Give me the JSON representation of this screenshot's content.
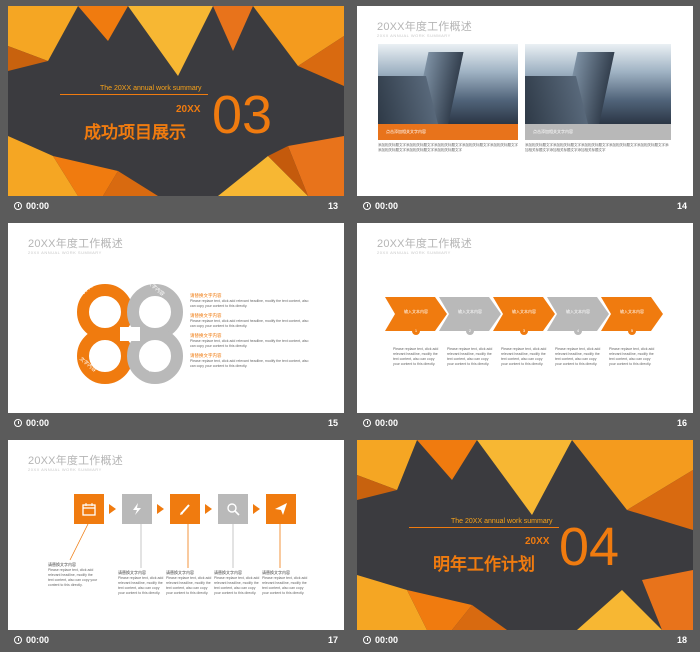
{
  "colors": {
    "accent": "#f07b0f",
    "gray": "#b9b9b9",
    "background": "#5b5b5b",
    "dark_slide": "#3b3b3f"
  },
  "slides": [
    {
      "number": "13",
      "time": "00:00",
      "section": {
        "subtitle": "The 20XX annual work summary",
        "year": "20XX",
        "title": "成功项目展示",
        "num": "03"
      }
    },
    {
      "number": "14",
      "time": "00:00",
      "head": "20XX年度工作概述",
      "sub": "20XX ANNUAL WORK SUMMARY",
      "captions": [
        "点击添加相关文字内容",
        "点击添加相关文字内容"
      ],
      "body": "添加相关标题文字添加相关标题文字添加相关标题文字添加相关标题文字添加相关标题文字添加相关标题文字添加相关标题文字添加相关标题文字"
    },
    {
      "number": "15",
      "time": "00:00",
      "head": "20XX年度工作概述",
      "sub": "20XX ANNUAL WORK SUMMARY",
      "knot_labels": [
        "文字内容",
        "文字内容",
        "文字内容",
        "文字内容"
      ],
      "items": [
        {
          "title": "请替换文字内容",
          "text": "Please replace text, click add relevant headline, modify the text content, also can copy your content to this directly."
        },
        {
          "title": "请替换文字内容",
          "text": "Please replace text, click add relevant headline, modify the text content, also can copy your content to this directly."
        },
        {
          "title": "请替换文字内容",
          "text": "Please replace text, click add relevant headline, modify the text content, also can copy your content to this directly."
        },
        {
          "title": "请替换文字内容",
          "text": "Please replace text, click add relevant headline, modify the text content, also can copy your content to this directly."
        }
      ]
    },
    {
      "number": "16",
      "time": "00:00",
      "head": "20XX年度工作概述",
      "sub": "20XX ANNUAL WORK SUMMARY",
      "steps": [
        "输入文本内容",
        "输入文本内容",
        "输入文本内容",
        "输入文本内容",
        "输入文本内容"
      ],
      "step_nums": [
        "1",
        "2",
        "3",
        "4",
        "5"
      ],
      "step_text": "Please replace text, click add relevant headline, modify the text content, also can copy your content to this directly."
    },
    {
      "number": "17",
      "time": "00:00",
      "head": "20XX年度工作概述",
      "sub": "20XX ANNUAL WORK SUMMARY",
      "icons": [
        "calendar-icon",
        "lightning-icon",
        "pencil-icon",
        "magnifier-icon",
        "paper-plane-icon"
      ],
      "labels": [
        "请替换文字内容",
        "请替换文字内容",
        "请替换文字内容",
        "请替换文字内容",
        "请替换文字内容"
      ],
      "label_text": "Please replace text, click add relevant headline, modify the text content, also can copy your content to this directly."
    },
    {
      "number": "18",
      "time": "00:00",
      "section": {
        "subtitle": "The 20XX annual work summary",
        "year": "20XX",
        "title": "明年工作计划",
        "num": "04"
      }
    }
  ]
}
